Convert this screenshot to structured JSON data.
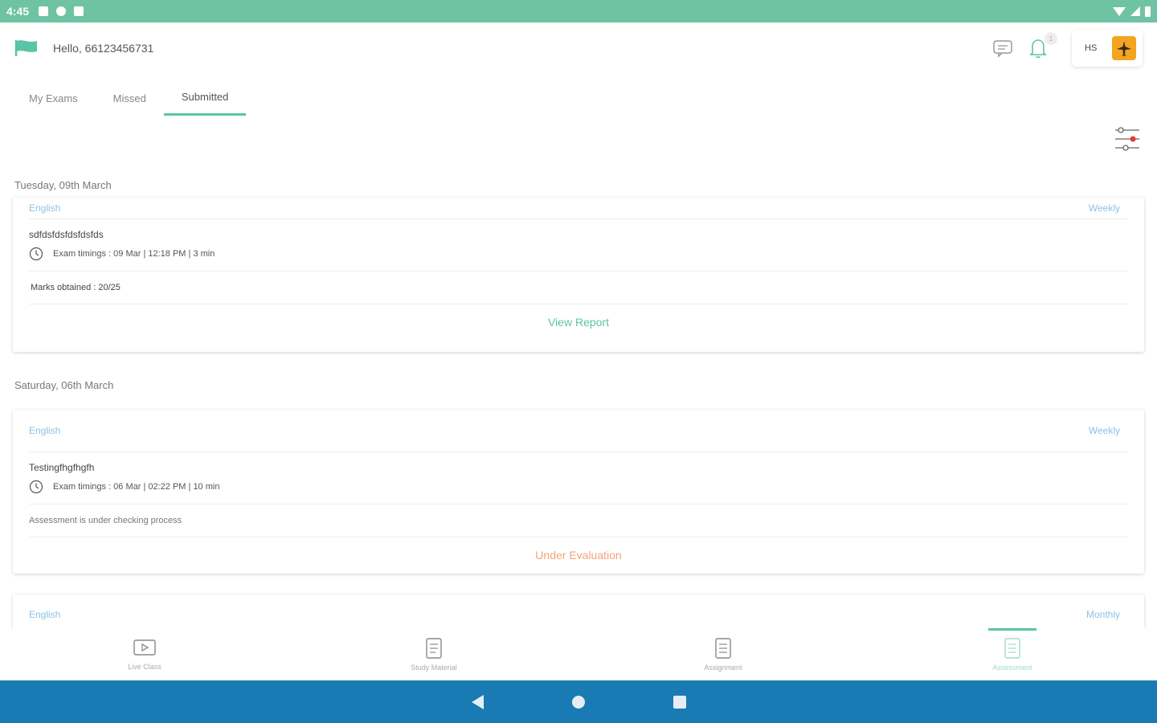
{
  "status_bar": {
    "time": "4:45"
  },
  "header": {
    "greeting": "Hello, 66123456731",
    "notification_count": "1",
    "profile_initials": "HS"
  },
  "tabs": [
    {
      "label": "My Exams"
    },
    {
      "label": "Missed"
    },
    {
      "label": "Submitted"
    }
  ],
  "active_tab": "Submitted",
  "sections": [
    {
      "date": "Tuesday, 09th March",
      "card": {
        "subject": "English",
        "frequency": "Weekly",
        "title": "sdfdsfdsfdsfdsfds",
        "timing": "Exam timings : 09 Mar | 12:18 PM | 3 min",
        "marks": "Marks obtained :  20/25",
        "action": "View Report"
      }
    },
    {
      "date": "Saturday, 06th March",
      "card": {
        "subject": "English",
        "frequency": "Weekly",
        "title": "Testingfhgfhgfh",
        "timing": "Exam timings : 06 Mar | 02:22 PM | 10 min",
        "note": "Assessment is under checking process",
        "action": "Under Evaluation"
      }
    },
    {
      "card": {
        "subject": "English",
        "frequency": "Monthly"
      }
    }
  ],
  "bottom_nav": [
    {
      "label": "Live Class",
      "icon": "play-video-icon"
    },
    {
      "label": "Study Material",
      "icon": "document-icon"
    },
    {
      "label": "Assignment",
      "icon": "assignment-icon"
    },
    {
      "label": "Assessment",
      "icon": "assessment-icon"
    }
  ],
  "colors": {
    "status_bar": "#6fc3a3",
    "accent": "#5bc4a6",
    "link": "#8dc2e6",
    "evaluation": "#f3a47a",
    "system_nav": "#1a7bb4"
  }
}
